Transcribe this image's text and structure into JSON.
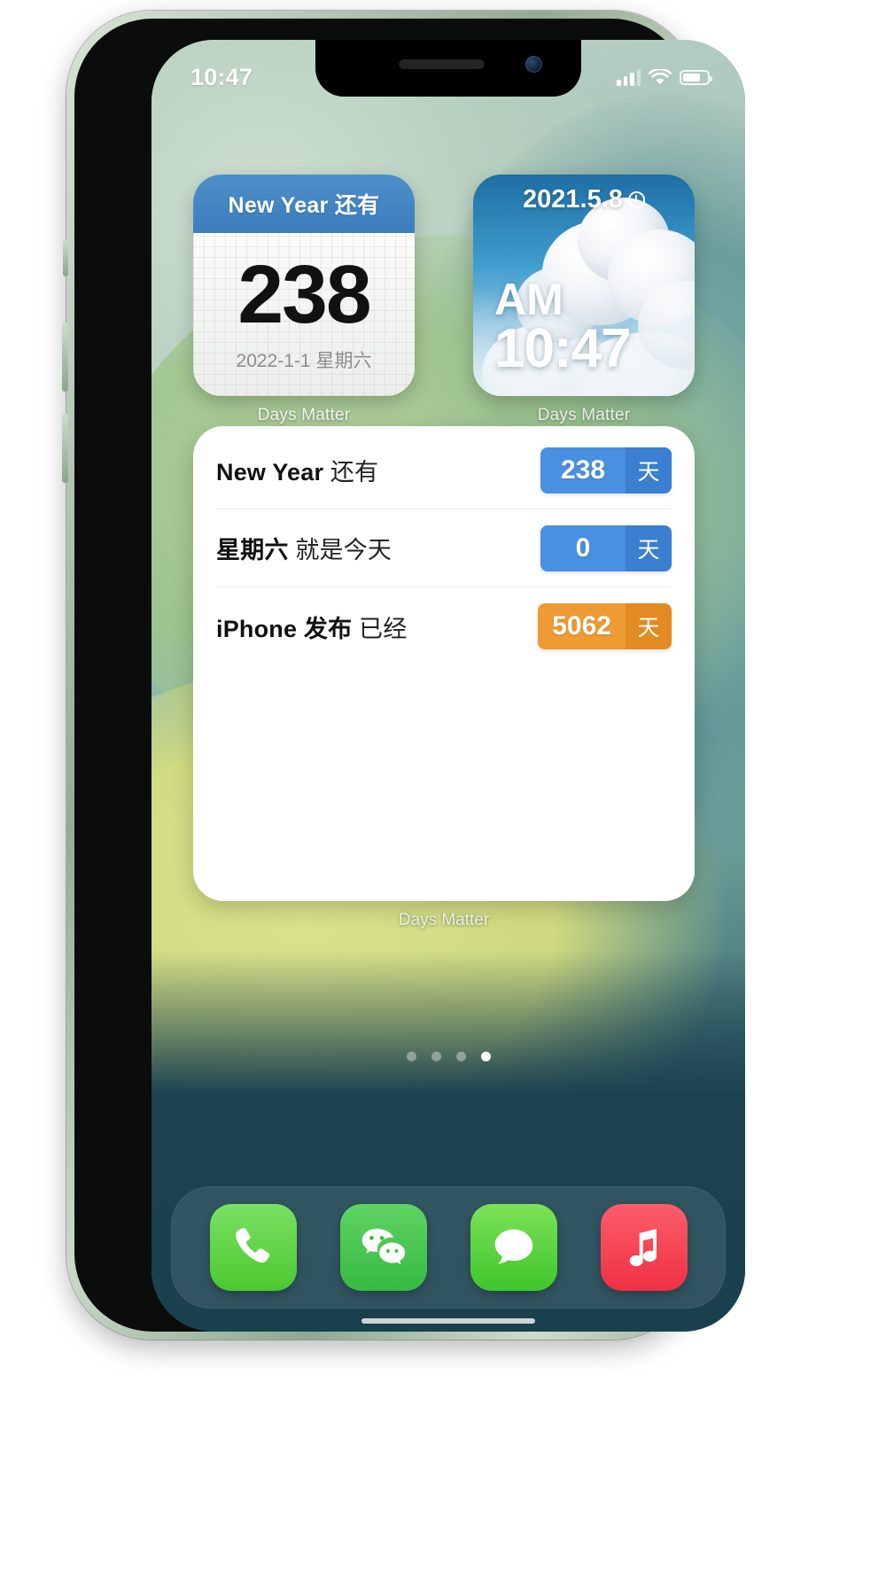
{
  "device": {
    "name": "iPhone 12 green",
    "frame_color": "#9fb6a0"
  },
  "status_bar": {
    "time": "10:47",
    "signal_icon": "cellular-signal-icon",
    "signal_bars": 3,
    "wifi_icon": "wifi-icon",
    "battery_icon": "battery-icon",
    "battery_level_pct": 72
  },
  "widgets": {
    "calendar": {
      "name": "days-matter-calendar-widget",
      "header": "New Year 还有",
      "count": "238",
      "date": "2022-1-1 星期六",
      "app_label": "Days Matter",
      "header_color": "#3b7ebd"
    },
    "clock": {
      "name": "days-matter-photo-clock-widget",
      "header": "2021.5.8",
      "header_icon": "clock-icon",
      "ampm": "AM",
      "time": "10:47",
      "app_label": "Days Matter"
    },
    "list": {
      "name": "days-matter-list-widget",
      "app_label": "Days Matter",
      "unit": "天",
      "rows": [
        {
          "title_main": "New Year",
          "title_sub": "还有",
          "value": "238",
          "unit": "天",
          "color": "blue"
        },
        {
          "title_main": "星期六",
          "title_sub": "就是今天",
          "value": "0",
          "unit": "天",
          "color": "blue"
        },
        {
          "title_main": "iPhone 发布",
          "title_sub": "已经",
          "value": "5062",
          "unit": "天",
          "color": "orange"
        }
      ]
    }
  },
  "page_indicator": {
    "total": 4,
    "active_index": 3
  },
  "dock": {
    "items": [
      {
        "name": "phone-app-icon",
        "label": "Phone",
        "icon": "phone-icon",
        "color": "#4cc92f"
      },
      {
        "name": "wechat-app-icon",
        "label": "WeChat",
        "icon": "wechat-icon",
        "color": "#37b943"
      },
      {
        "name": "messages-app-icon",
        "label": "Messages",
        "icon": "message-bubble-icon",
        "color": "#3fc62c"
      },
      {
        "name": "music-app-icon",
        "label": "Music",
        "icon": "music-note-icon",
        "color": "#ef3143"
      }
    ]
  },
  "colors": {
    "badge_blue": "#4a90e2",
    "badge_blue_dark": "#3a7fd0",
    "badge_orange": "#ef9b33",
    "badge_orange_dark": "#e38a22",
    "calendar_header": "#3b7ebd"
  }
}
